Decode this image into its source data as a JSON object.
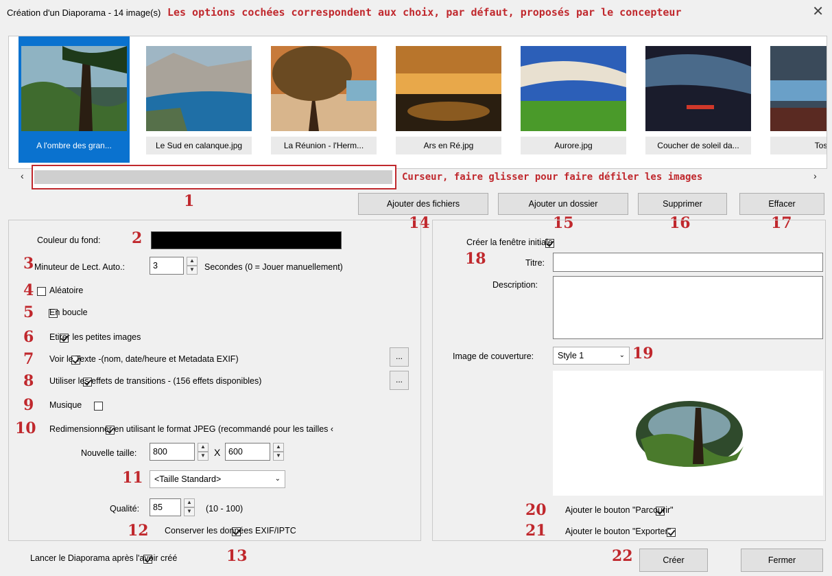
{
  "window": {
    "title": "Création d'un Diaporama - 14 image(s)",
    "note": "Les options cochées correspondent aux choix, par défaut, proposés par le concepteur",
    "close_symbol": "✕"
  },
  "thumbnails": [
    {
      "caption": "A  l'ombre des gran...",
      "selected": true
    },
    {
      "caption": "Le Sud en calanque.jpg",
      "selected": false
    },
    {
      "caption": "La Réunion - l'Herm...",
      "selected": false
    },
    {
      "caption": "Ars en Ré.jpg",
      "selected": false
    },
    {
      "caption": "Aurore.jpg",
      "selected": false
    },
    {
      "caption": "Coucher de soleil da...",
      "selected": false
    },
    {
      "caption": "Tosc",
      "selected": false
    }
  ],
  "scrollbar": {
    "left_arrow": "‹",
    "right_arrow": "›",
    "note": "Curseur, faire glisser pour faire défiler les images"
  },
  "annotations": {
    "n1": "1",
    "n2": "2",
    "n3": "3",
    "n4": "4",
    "n5": "5",
    "n6": "6",
    "n7": "7",
    "n8": "8",
    "n9": "9",
    "n10": "10",
    "n11": "11",
    "n12": "12",
    "n13": "13",
    "n14": "14",
    "n15": "15",
    "n16": "16",
    "n17": "17",
    "n18": "18",
    "n19": "19",
    "n20": "20",
    "n21": "21",
    "n22": "22"
  },
  "toolbar": {
    "add_files": "Ajouter des fichiers",
    "add_folder": "Ajouter un dossier",
    "delete": "Supprimer",
    "clear": "Effacer"
  },
  "left": {
    "bg_color_label": "Couleur du fond:",
    "bg_color": "#000000",
    "timer_label": "Minuteur de Lect. Auto.:",
    "timer_value": "3",
    "timer_suffix": "Secondes (0 = Jouer  manuellement)",
    "random": "Aléatoire",
    "loop": "En boucle",
    "stretch": "Etirer les petites images",
    "show_text": "Voir le Texte -(nom, date/heure et Metadata EXIF)",
    "transitions": "Utiliser les effets de transitions  -  (156 effets disponibles)",
    "music": "Musique",
    "resize": "Redimensionner en utilisant le format JPEG (recommandé pour les tailles ‹",
    "new_size_label": "Nouvelle taille:",
    "width": "800",
    "x": "X",
    "height": "600",
    "size_preset": "<Taille Standard>",
    "quality_label": "Qualité:",
    "quality": "85",
    "quality_range": "(10 - 100)",
    "keep_exif": "Conserver les données EXIF/IPTC",
    "more": "..."
  },
  "right": {
    "create_window": "Créer la fenêtre initiale",
    "title_label": "Titre:",
    "title_value": "",
    "desc_label": "Description:",
    "desc_value": "",
    "cover_label": "Image de couverture:",
    "cover_style": "Style 1",
    "add_browse": "Ajouter le bouton \"Parcourir\"",
    "add_export": "Ajouter le bouton \"Exporter\""
  },
  "footer": {
    "launch": "Lancer le Diaporama après l'avoir créé",
    "create": "Créer",
    "close": "Fermer"
  },
  "colors": {
    "accent": "#0a72cf",
    "annotation": "#c0282d"
  }
}
